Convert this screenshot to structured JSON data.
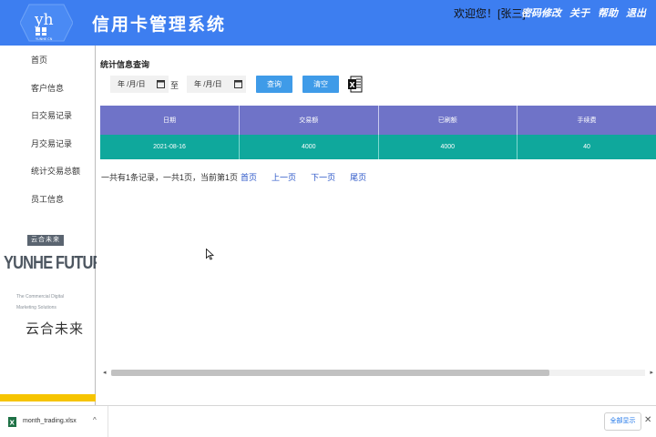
{
  "header": {
    "logo_text": "yh",
    "logo_sub": "YUNHE CN",
    "title": "信用卡管理系统",
    "welcome": "欢迎您！[张三]",
    "links": [
      "密码修改",
      "关于",
      "帮助",
      "退出"
    ],
    "bg_color": "#3d7ef0"
  },
  "sidebar": {
    "items": [
      "首页",
      "客户信息",
      "日交易记录",
      "月交易记录",
      "统计交易总额",
      "员工信息"
    ],
    "brand_badge": "云合未来",
    "brand_big": "YUNHE FUTURE",
    "brand_small": "The Commercial Digital Marketing Solutions",
    "brand_cn": "云合未来"
  },
  "main": {
    "section_title": "统计信息查询",
    "date_from": {
      "placeholder": "年 /月/日"
    },
    "to_label": "至",
    "date_to": {
      "placeholder": "年 /月/日"
    },
    "query_button": "查询",
    "clear_button": "清空",
    "export_icon": "excel-icon",
    "table": {
      "headers": [
        "日期",
        "交易额",
        "已刷额",
        "手续费"
      ],
      "rows": [
        [
          "2021-08-16",
          "4000",
          "4000",
          "40"
        ]
      ],
      "header_color": "#6f73c8",
      "row_color": "#0fa89c"
    },
    "pager": {
      "summary": "一共有1条记录，一共1页，当前第1页",
      "first": "首页",
      "prev": "上一页",
      "next": "下一页",
      "last": "尾页"
    },
    "scroll_thumb_fraction": 0.82
  },
  "download_bar": {
    "file_name": "month_trading.xlsx",
    "show_all": "全部显示"
  }
}
